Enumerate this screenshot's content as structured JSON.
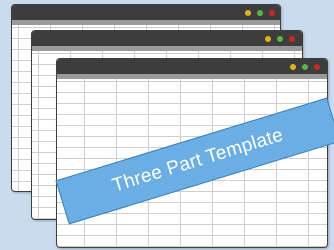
{
  "banner": {
    "text": "Three Part Template"
  },
  "colors": {
    "background": "#c9dcef",
    "titlebar": "#3d3d3d",
    "dot_yellow": "#e0b21a",
    "dot_green": "#5bb544",
    "dot_red": "#c62828",
    "banner": "#6aaee3"
  },
  "windows": [
    {
      "icons": [
        "yellow-dot-icon",
        "green-dot-icon",
        "red-dot-icon"
      ]
    },
    {
      "icons": [
        "yellow-dot-icon",
        "green-dot-icon",
        "red-dot-icon"
      ]
    },
    {
      "icons": [
        "yellow-dot-icon",
        "green-dot-icon",
        "red-dot-icon"
      ]
    }
  ]
}
